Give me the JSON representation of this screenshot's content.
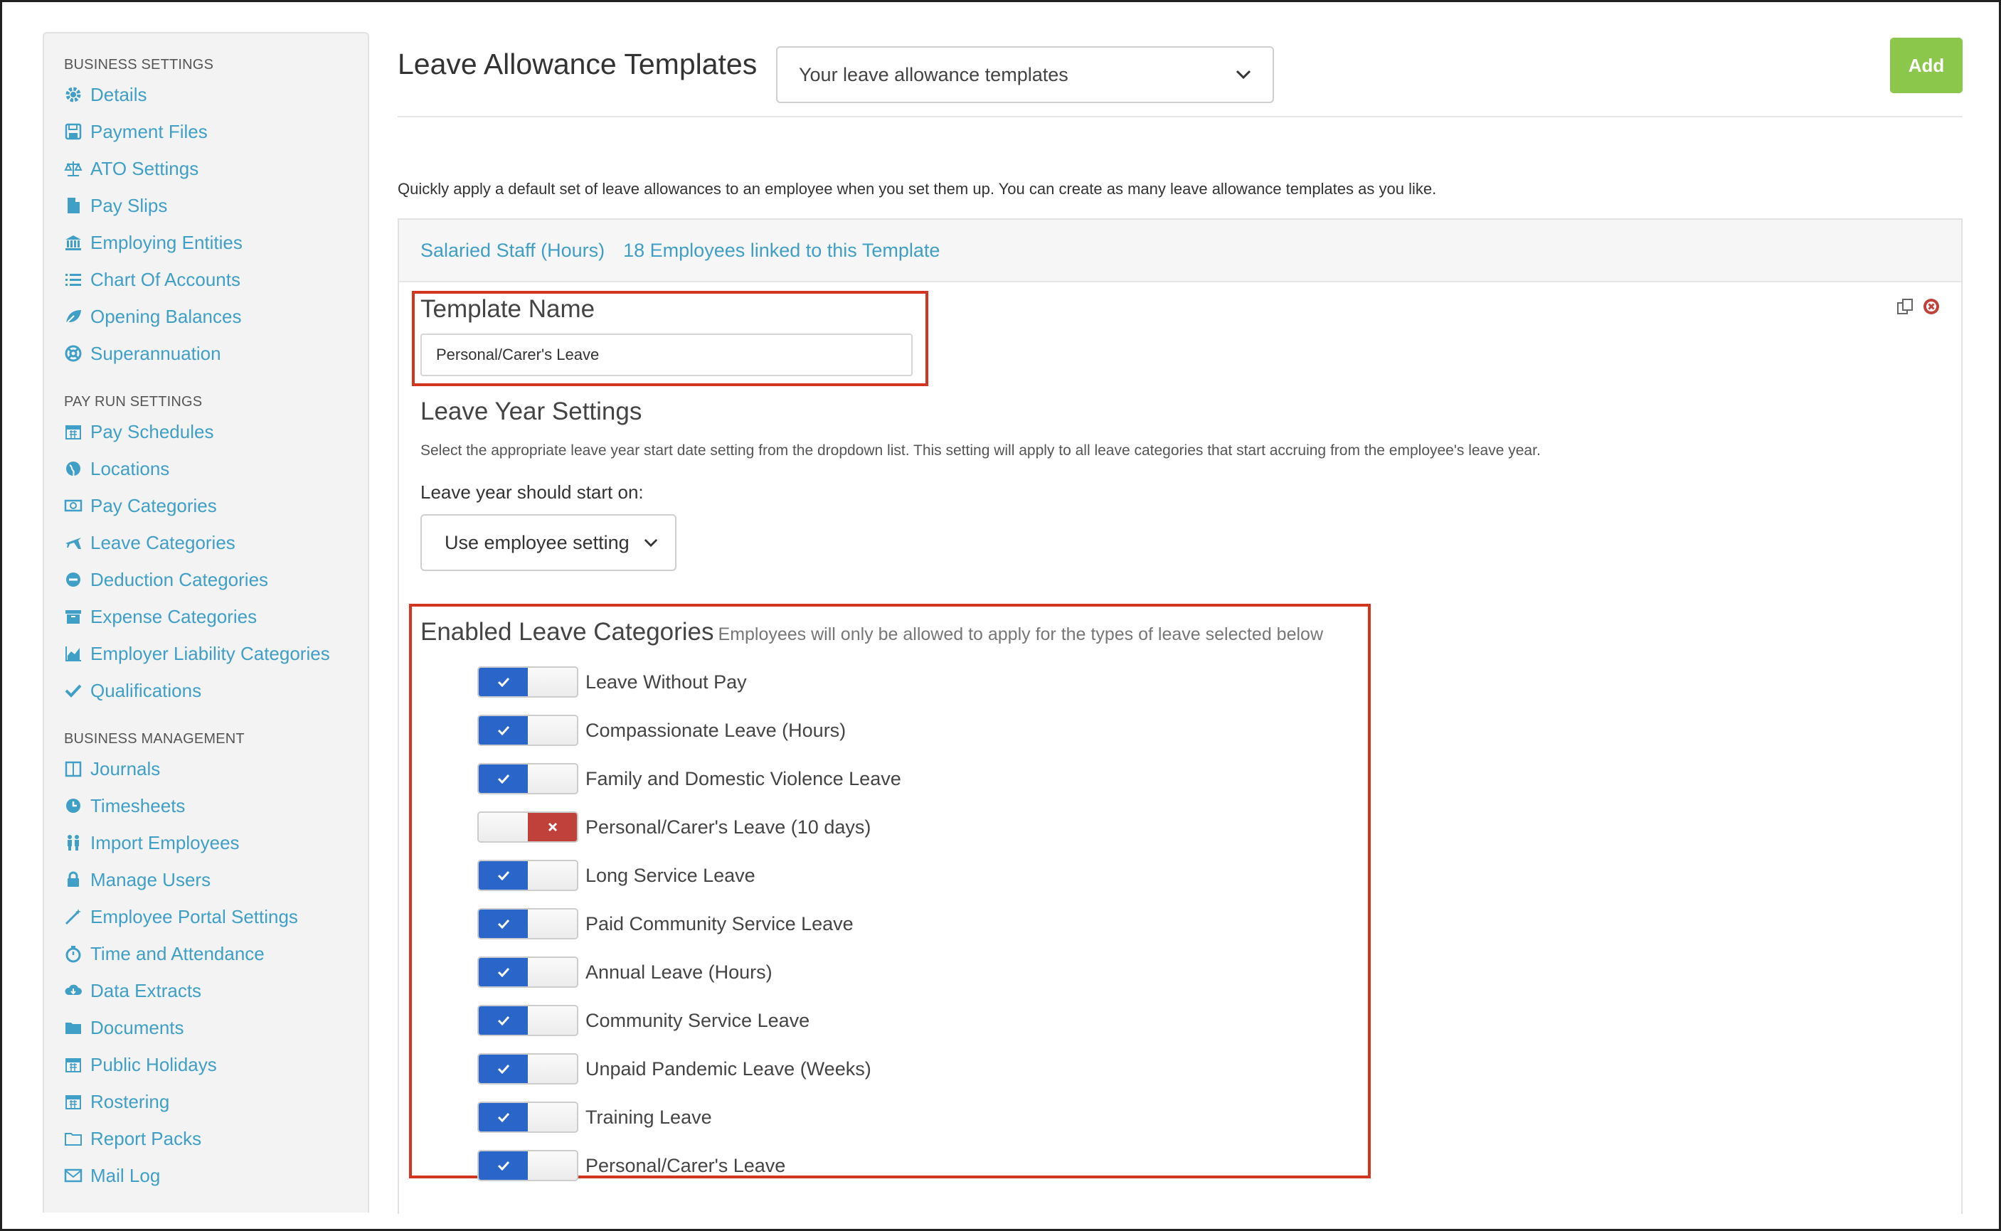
{
  "sidebar": {
    "sections": [
      {
        "header": "BUSINESS SETTINGS",
        "items": [
          {
            "label": "Details",
            "icon": "gear-icon"
          },
          {
            "label": "Payment Files",
            "icon": "floppy-icon"
          },
          {
            "label": "ATO Settings",
            "icon": "scales-icon"
          },
          {
            "label": "Pay Slips",
            "icon": "file-icon"
          },
          {
            "label": "Employing Entities",
            "icon": "bank-icon"
          },
          {
            "label": "Chart Of Accounts",
            "icon": "list-icon"
          },
          {
            "label": "Opening Balances",
            "icon": "leaf-icon"
          },
          {
            "label": "Superannuation",
            "icon": "lifebuoy-icon"
          }
        ]
      },
      {
        "header": "PAY RUN SETTINGS",
        "items": [
          {
            "label": "Pay Schedules",
            "icon": "calendar-icon"
          },
          {
            "label": "Locations",
            "icon": "globe-icon"
          },
          {
            "label": "Pay Categories",
            "icon": "money-icon"
          },
          {
            "label": "Leave Categories",
            "icon": "plane-icon"
          },
          {
            "label": "Deduction Categories",
            "icon": "minus-circle-icon"
          },
          {
            "label": "Expense Categories",
            "icon": "archive-icon"
          },
          {
            "label": "Employer Liability Categories",
            "icon": "chart-area-icon"
          },
          {
            "label": "Qualifications",
            "icon": "check-icon"
          }
        ]
      },
      {
        "header": "BUSINESS MANAGEMENT",
        "items": [
          {
            "label": "Journals",
            "icon": "book-icon"
          },
          {
            "label": "Timesheets",
            "icon": "clock-icon"
          },
          {
            "label": "Import Employees",
            "icon": "users-icon"
          },
          {
            "label": "Manage Users",
            "icon": "lock-icon"
          },
          {
            "label": "Employee Portal Settings",
            "icon": "wand-icon"
          },
          {
            "label": "Time and Attendance",
            "icon": "stopwatch-icon"
          },
          {
            "label": "Data Extracts",
            "icon": "cloud-download-icon"
          },
          {
            "label": "Documents",
            "icon": "folder-icon"
          },
          {
            "label": "Public Holidays",
            "icon": "calendar-icon"
          },
          {
            "label": "Rostering",
            "icon": "calendar-icon"
          },
          {
            "label": "Report Packs",
            "icon": "folder-open-icon"
          },
          {
            "label": "Mail Log",
            "icon": "envelope-icon"
          }
        ]
      }
    ]
  },
  "header": {
    "title": "Leave Allowance Templates",
    "template_select": "Your leave allowance templates",
    "add_label": "Add"
  },
  "intro": "Quickly apply a default set of leave allowances to an employee when you set them up. You can create as many leave allowance templates as you like.",
  "panel": {
    "template_link": "Salaried Staff (Hours)",
    "employees_link": "18 Employees linked to this Template",
    "template_name_label": "Template Name",
    "template_name_value": "Personal/Carer's Leave",
    "leave_year_title": "Leave Year Settings",
    "leave_year_desc": "Select the appropriate leave year start date setting from the dropdown list. This setting will apply to all leave categories that start accruing from the employee's leave year.",
    "leave_year_label": "Leave year should start on:",
    "leave_year_select": "Use employee setting",
    "enabled_title": "Enabled Leave Categories",
    "enabled_hint": "Employees will only be allowed to apply for the types of leave selected below",
    "categories": [
      {
        "label": "Leave Without Pay",
        "enabled": true
      },
      {
        "label": "Compassionate Leave (Hours)",
        "enabled": true
      },
      {
        "label": "Family and Domestic Violence Leave",
        "enabled": true
      },
      {
        "label": "Personal/Carer's Leave (10 days)",
        "enabled": false
      },
      {
        "label": "Long Service Leave",
        "enabled": true
      },
      {
        "label": "Paid Community Service Leave",
        "enabled": true
      },
      {
        "label": "Annual Leave (Hours)",
        "enabled": true
      },
      {
        "label": "Community Service Leave",
        "enabled": true
      },
      {
        "label": "Unpaid Pandemic Leave (Weeks)",
        "enabled": true
      },
      {
        "label": "Training Leave",
        "enabled": true
      },
      {
        "label": "Personal/Carer's Leave",
        "enabled": true
      }
    ]
  },
  "colors": {
    "link": "#3f9fc6",
    "add_button": "#8bc74a",
    "toggle_on": "#2a66c9",
    "toggle_off": "#c0413a",
    "highlight": "#d2361f"
  }
}
